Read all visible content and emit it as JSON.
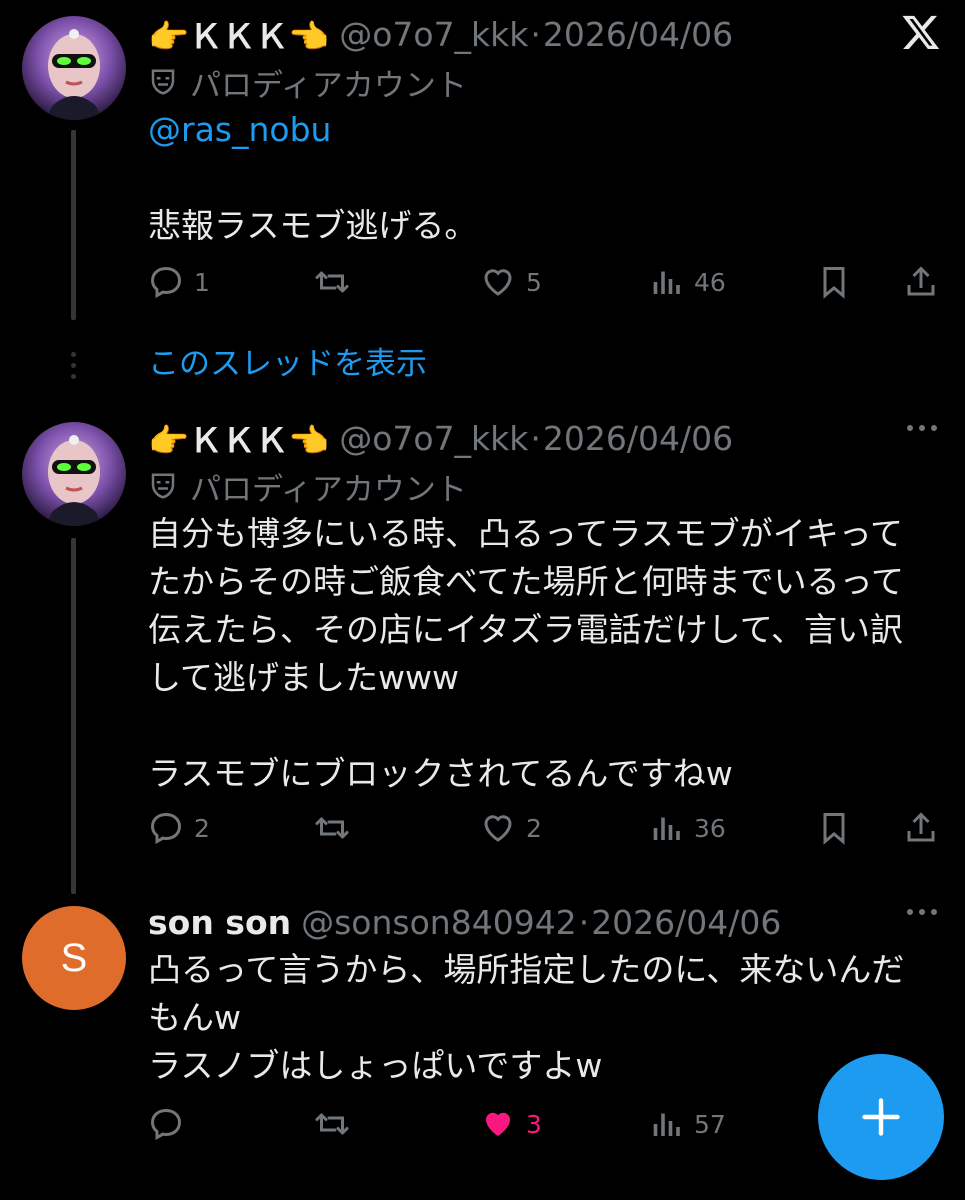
{
  "header": {
    "x_logo": "x-logo-icon"
  },
  "tweets": [
    {
      "name": "👉ＫＫＫ👈",
      "handle": "@o7o7_kkk",
      "sep": "·",
      "date": "2026/04/06",
      "parody_label": "パロディアカウント",
      "mention": "@ras_nobu",
      "text": "悲報ラスモブ逃げる。",
      "replies": "1",
      "likes": "5",
      "views": "46"
    },
    {
      "name": "👉ＫＫＫ👈",
      "handle": "@o7o7_kkk",
      "sep": "·",
      "date": "2026/04/06",
      "parody_label": "パロディアカウント",
      "text": "自分も博多にいる時、凸るってラスモブがイキって\nたからその時ご飯食べてた場所と何時までいるって\n伝えたら、その店にイタズラ電話だけして、言い訳\nして逃げましたwww\n\nラスモブにブロックされてるんですねw",
      "replies": "2",
      "likes": "2",
      "views": "36"
    },
    {
      "name": "son son",
      "handle": "@sonson840942",
      "sep": "·",
      "date": "2026/04/06",
      "avatar_letter": "S",
      "text": "凸るって言うから、場所指定したのに、来ないんだ\nもんw\nラスノブはしょっぱいですよw",
      "replies": "",
      "likes": "3",
      "views": "57"
    }
  ],
  "show_thread": "このスレッドを表示",
  "colors": {
    "accent": "#1d9bf0",
    "like": "#f91880",
    "muted": "#71767b",
    "avatar_s": "#e06c2c"
  }
}
